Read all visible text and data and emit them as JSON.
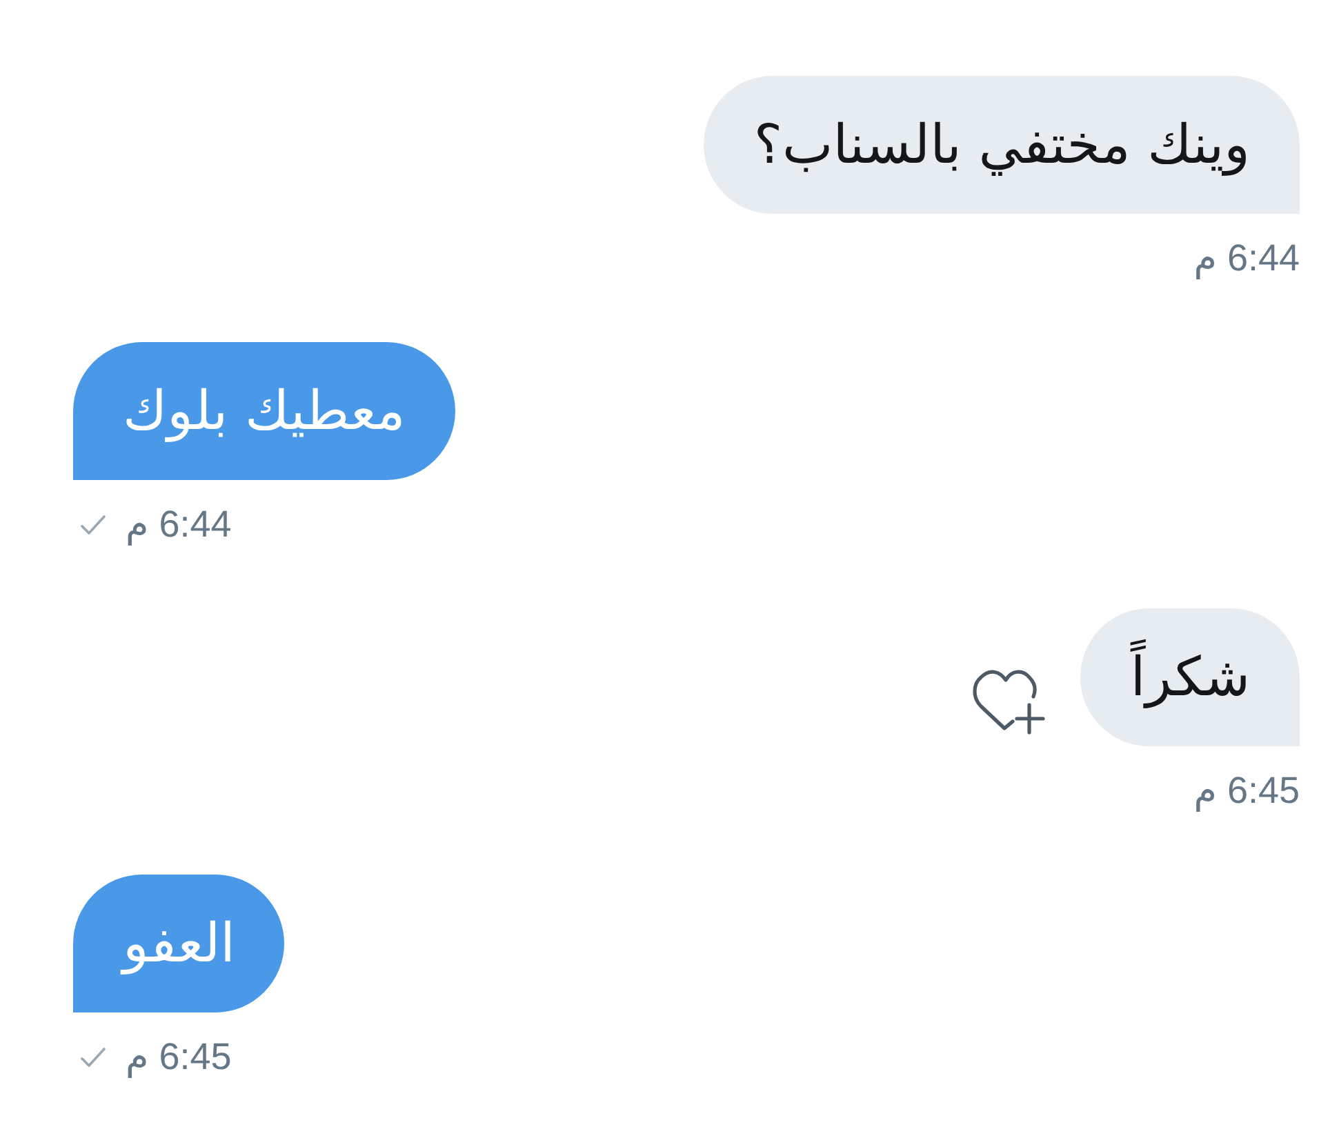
{
  "messages": [
    {
      "kind": "received",
      "text": "وينك مختفي بالسناب؟",
      "time": "6:44 م",
      "sent_check": false,
      "reaction_button": false
    },
    {
      "kind": "sent",
      "text": "معطيك بلوك",
      "time": "6:44 م",
      "sent_check": true,
      "reaction_button": false
    },
    {
      "kind": "received",
      "text": "شكراً",
      "time": "6:45 م",
      "sent_check": false,
      "reaction_button": true
    },
    {
      "kind": "sent",
      "text": "العفو",
      "time": "6:45 م",
      "sent_check": true,
      "reaction_button": false
    }
  ]
}
